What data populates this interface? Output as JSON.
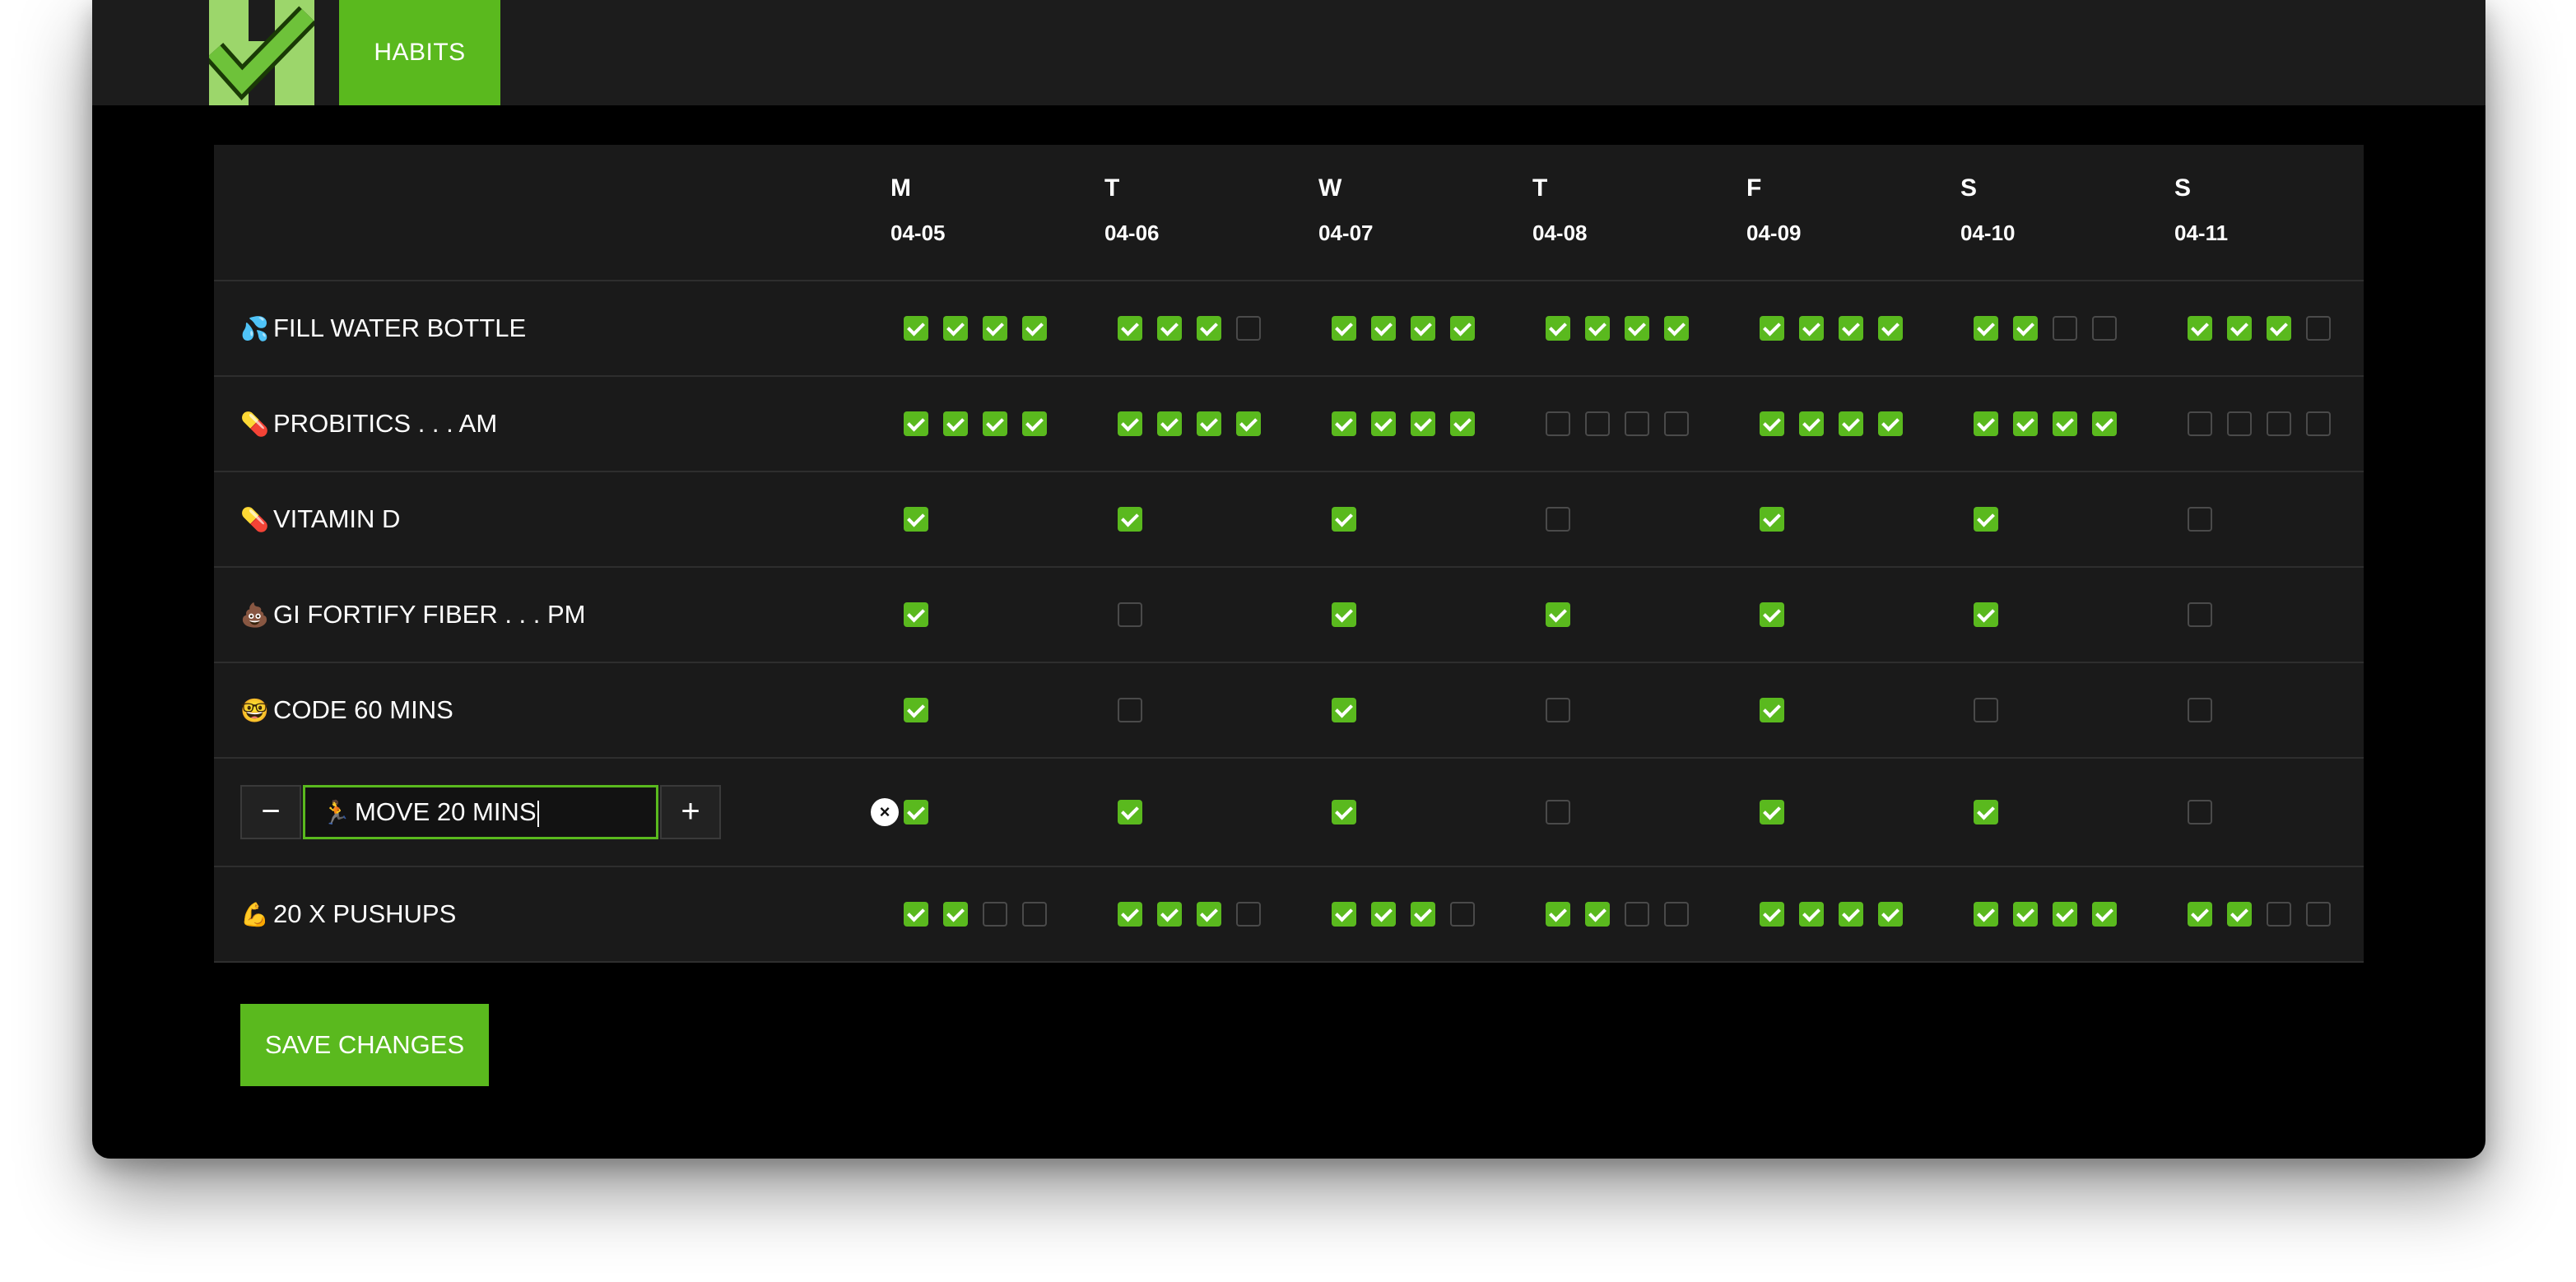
{
  "colors": {
    "accent": "#5ab91e",
    "background": "#000000",
    "panel": "#1a1a1a",
    "header": "#1c1c1c"
  },
  "header": {
    "logo_icon": "check-h-logo-icon",
    "tab_label": "HABITS"
  },
  "days": [
    {
      "letter": "M",
      "date": "04-05"
    },
    {
      "letter": "T",
      "date": "04-06"
    },
    {
      "letter": "W",
      "date": "04-07"
    },
    {
      "letter": "T",
      "date": "04-08"
    },
    {
      "letter": "F",
      "date": "04-09"
    },
    {
      "letter": "S",
      "date": "04-10"
    },
    {
      "letter": "S",
      "date": "04-11"
    }
  ],
  "habits": [
    {
      "emoji": "💦",
      "name": "FILL WATER BOTTLE",
      "checks": [
        [
          1,
          1,
          1,
          1
        ],
        [
          1,
          1,
          1,
          0
        ],
        [
          1,
          1,
          1,
          1
        ],
        [
          1,
          1,
          1,
          1
        ],
        [
          1,
          1,
          1,
          1
        ],
        [
          1,
          1,
          0,
          0
        ],
        [
          1,
          1,
          1,
          0
        ]
      ]
    },
    {
      "emoji": "💊",
      "name": "PROBITICS . . . AM",
      "checks": [
        [
          1,
          1,
          1,
          1
        ],
        [
          1,
          1,
          1,
          1
        ],
        [
          1,
          1,
          1,
          1
        ],
        [
          0,
          0,
          0,
          0
        ],
        [
          1,
          1,
          1,
          1
        ],
        [
          1,
          1,
          1,
          1
        ],
        [
          0,
          0,
          0,
          0
        ]
      ]
    },
    {
      "emoji": "💊",
      "name": "VITAMIN D",
      "checks": [
        [
          1
        ],
        [
          1
        ],
        [
          1
        ],
        [
          0
        ],
        [
          1
        ],
        [
          1
        ],
        [
          0
        ]
      ]
    },
    {
      "emoji": "💩",
      "name": "GI FORTIFY FIBER . . . PM",
      "checks": [
        [
          1
        ],
        [
          0
        ],
        [
          1
        ],
        [
          1
        ],
        [
          1
        ],
        [
          1
        ],
        [
          0
        ]
      ]
    },
    {
      "emoji": "🤓",
      "name": "CODE 60 MINS",
      "checks": [
        [
          1
        ],
        [
          0
        ],
        [
          1
        ],
        [
          0
        ],
        [
          1
        ],
        [
          0
        ],
        [
          0
        ]
      ]
    },
    {
      "emoji": "🏃",
      "name": "MOVE 20 MINS",
      "editing": true,
      "checks": [
        [
          1
        ],
        [
          1
        ],
        [
          1
        ],
        [
          0
        ],
        [
          1
        ],
        [
          1
        ],
        [
          0
        ]
      ]
    },
    {
      "emoji": "💪",
      "name": "20 X PUSHUPS",
      "checks": [
        [
          1,
          1,
          0,
          0
        ],
        [
          1,
          1,
          1,
          0
        ],
        [
          1,
          1,
          1,
          0
        ],
        [
          1,
          1,
          0,
          0
        ],
        [
          1,
          1,
          1,
          1
        ],
        [
          1,
          1,
          1,
          1
        ],
        [
          1,
          1,
          0,
          0
        ]
      ]
    }
  ],
  "editor": {
    "minus_label": "−",
    "plus_label": "+",
    "remove_label": "×"
  },
  "actions": {
    "save_label": "SAVE CHANGES"
  }
}
